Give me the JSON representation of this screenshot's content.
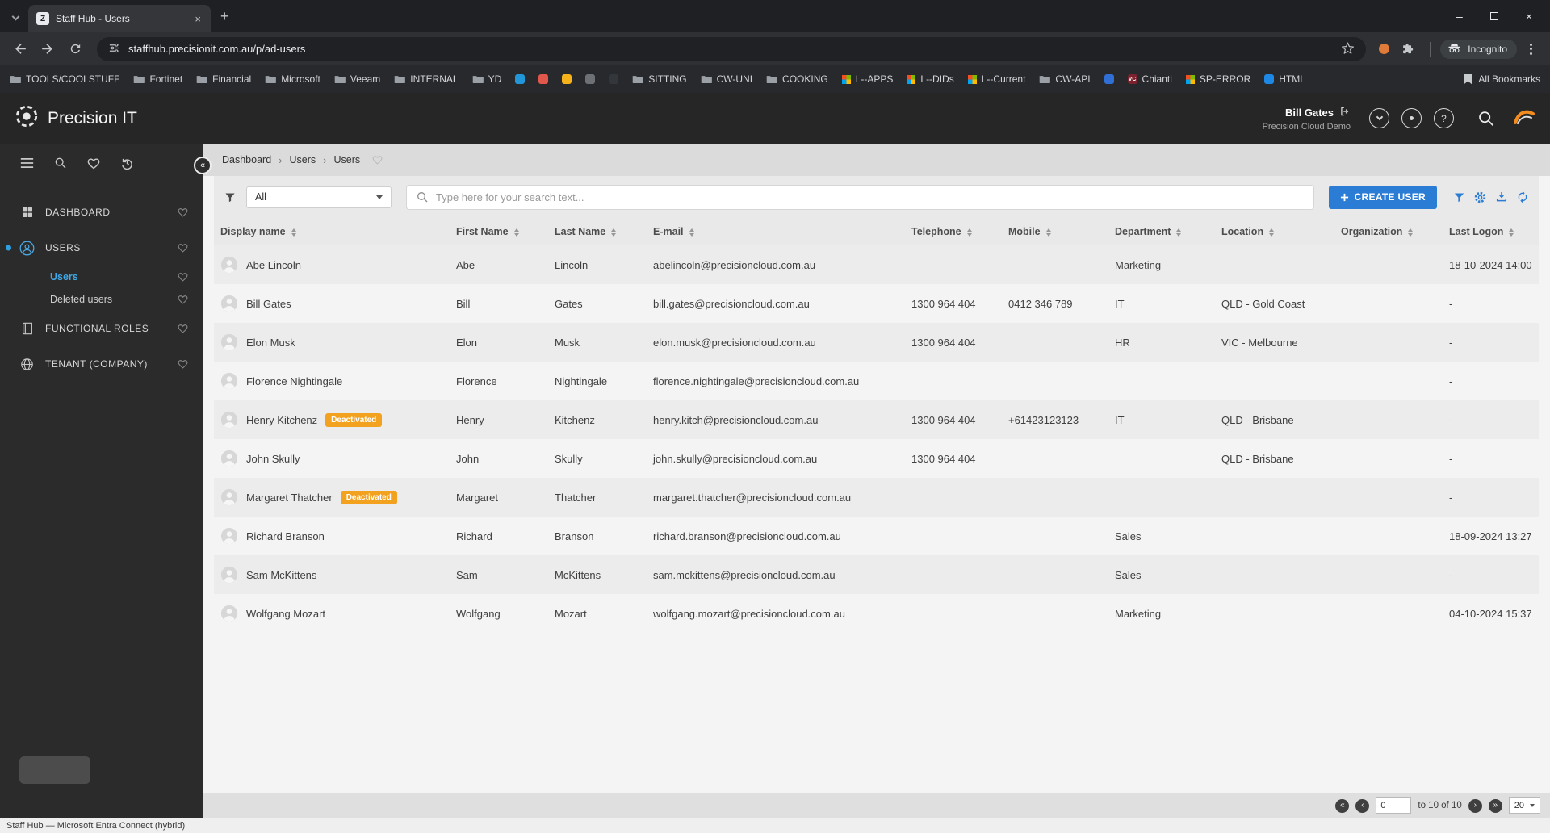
{
  "browser": {
    "tab": {
      "title": "Staff Hub - Users",
      "favicon_text": "Z"
    },
    "url": "staffhub.precisionit.com.au/p/ad-users",
    "incognito_label": "Incognito",
    "all_bookmarks_label": "All Bookmarks",
    "bookmarks": [
      {
        "label": "TOOLS/COOLSTUFF",
        "icon": "folder"
      },
      {
        "label": "Fortinet",
        "icon": "folder"
      },
      {
        "label": "Financial",
        "icon": "folder"
      },
      {
        "label": "Microsoft",
        "icon": "folder"
      },
      {
        "label": "Veeam",
        "icon": "folder"
      },
      {
        "label": "INTERNAL",
        "icon": "folder"
      },
      {
        "label": "YD",
        "icon": "folder"
      },
      {
        "label": "",
        "icon": "dot",
        "color": "#2196d9"
      },
      {
        "label": "",
        "icon": "dot",
        "color": "#e2574c"
      },
      {
        "label": "",
        "icon": "dot",
        "color": "#f6b21b"
      },
      {
        "label": "",
        "icon": "dot",
        "color": "#6d7075"
      },
      {
        "label": "",
        "icon": "dot",
        "color": "#33363b"
      },
      {
        "label": "SITTING",
        "icon": "folder"
      },
      {
        "label": "CW-UNI",
        "icon": "folder"
      },
      {
        "label": "COOKING",
        "icon": "folder"
      },
      {
        "label": "L--APPS",
        "icon": "grid"
      },
      {
        "label": "L--DIDs",
        "icon": "grid"
      },
      {
        "label": "L--Current",
        "icon": "grid"
      },
      {
        "label": "CW-API",
        "icon": "folder"
      },
      {
        "label": "",
        "icon": "dot",
        "color": "#2f6fd6"
      },
      {
        "label": "Chianti",
        "icon": "badge",
        "color": "#7b222e",
        "text": "VC"
      },
      {
        "label": "SP-ERROR",
        "icon": "grid"
      },
      {
        "label": "HTML",
        "icon": "dot",
        "color": "#1e88e5"
      }
    ]
  },
  "glyphs": {
    "new_tab": "+",
    "tab_close": "×",
    "window_minimize": "–",
    "window_close": "×",
    "collapse_sidebar": "«",
    "breadcrumb_separator": "›",
    "help": "?",
    "pg_first": "«",
    "pg_prev": "‹",
    "pg_next": "›",
    "pg_last": "»"
  },
  "header": {
    "brand": "Precision IT",
    "user_name": "Bill Gates",
    "tenant": "Precision Cloud Demo"
  },
  "sidebar": {
    "items": [
      {
        "label": "DASHBOARD"
      },
      {
        "label": "USERS",
        "children": [
          {
            "label": "Users"
          },
          {
            "label": "Deleted users"
          }
        ]
      },
      {
        "label": "FUNCTIONAL ROLES"
      },
      {
        "label": "TENANT (COMPANY)"
      }
    ]
  },
  "breadcrumb": {
    "items": [
      "Dashboard",
      "Users",
      "Users"
    ]
  },
  "toolbar": {
    "filter_value": "All",
    "search_placeholder": "Type here for your search text...",
    "create_label": "CREATE USER"
  },
  "table": {
    "badge_deactivated": "Deactivated",
    "columns": [
      "Display name",
      "First Name",
      "Last Name",
      "E-mail",
      "Telephone",
      "Mobile",
      "Department",
      "Location",
      "Organization",
      "Last Logon"
    ],
    "rows": [
      {
        "display": "Abe Lincoln",
        "first": "Abe",
        "last": "Lincoln",
        "email": "abelincoln@precisioncloud.com.au",
        "phone": "",
        "mobile": "",
        "dept": "Marketing",
        "location": "",
        "org": "",
        "last_logon": "18-10-2024 14:00"
      },
      {
        "display": "Bill Gates",
        "first": "Bill",
        "last": "Gates",
        "email": "bill.gates@precisioncloud.com.au",
        "phone": "1300 964 404",
        "mobile": "0412 346 789",
        "dept": "IT",
        "location": "QLD - Gold Coast",
        "org": "",
        "last_logon": "-"
      },
      {
        "display": "Elon Musk",
        "first": "Elon",
        "last": "Musk",
        "email": "elon.musk@precisioncloud.com.au",
        "phone": "1300 964 404",
        "mobile": "",
        "dept": "HR",
        "location": "VIC - Melbourne",
        "org": "",
        "last_logon": "-"
      },
      {
        "display": "Florence Nightingale",
        "first": "Florence",
        "last": "Nightingale",
        "email": "florence.nightingale@precisioncloud.com.au",
        "phone": "",
        "mobile": "",
        "dept": "",
        "location": "",
        "org": "",
        "last_logon": "-"
      },
      {
        "display": "Henry Kitchenz",
        "deactivated": true,
        "first": "Henry",
        "last": "Kitchenz",
        "email": "henry.kitch@precisioncloud.com.au",
        "phone": "1300 964 404",
        "mobile": "+61423123123",
        "dept": "IT",
        "location": "QLD - Brisbane",
        "org": "",
        "last_logon": "-"
      },
      {
        "display": "John Skully",
        "first": "John",
        "last": "Skully",
        "email": "john.skully@precisioncloud.com.au",
        "phone": "1300 964 404",
        "mobile": "",
        "dept": "",
        "location": "QLD - Brisbane",
        "org": "",
        "last_logon": "-"
      },
      {
        "display": "Margaret Thatcher",
        "deactivated": true,
        "first": "Margaret",
        "last": "Thatcher",
        "email": "margaret.thatcher@precisioncloud.com.au",
        "phone": "",
        "mobile": "",
        "dept": "",
        "location": "",
        "org": "",
        "last_logon": "-"
      },
      {
        "display": "Richard Branson",
        "first": "Richard",
        "last": "Branson",
        "email": "richard.branson@precisioncloud.com.au",
        "phone": "",
        "mobile": "",
        "dept": "Sales",
        "location": "",
        "org": "",
        "last_logon": "18-09-2024 13:27"
      },
      {
        "display": "Sam McKittens",
        "first": "Sam",
        "last": "McKittens",
        "email": "sam.mckittens@precisioncloud.com.au",
        "phone": "",
        "mobile": "",
        "dept": "Sales",
        "location": "",
        "org": "",
        "last_logon": "-"
      },
      {
        "display": "Wolfgang Mozart",
        "first": "Wolfgang",
        "last": "Mozart",
        "email": "wolfgang.mozart@precisioncloud.com.au",
        "phone": "",
        "mobile": "",
        "dept": "Marketing",
        "location": "",
        "org": "",
        "last_logon": "04-10-2024 15:37"
      }
    ]
  },
  "pagination": {
    "page_value": "0",
    "range_text": "to 10 of 10",
    "page_size": "20"
  },
  "status_bar": "Staff Hub — Microsoft Entra Connect (hybrid)"
}
